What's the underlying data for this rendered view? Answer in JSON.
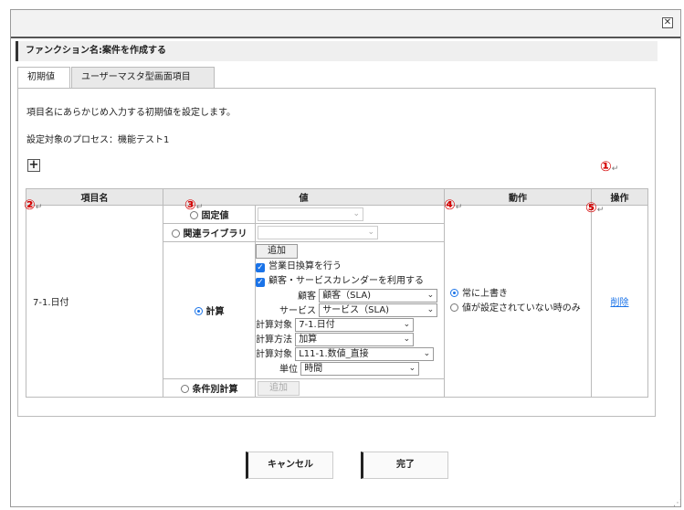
{
  "window": {
    "close_symbol": "✕"
  },
  "function_header": "ファンクション名:案件を作成する",
  "tabs": [
    {
      "label": "初期値",
      "active": true
    },
    {
      "label": "ユーザーマスタ型画面項目",
      "active": false
    }
  ],
  "description": "項目名にあらかじめ入力する初期値を設定します。",
  "process_label": "設定対象のプロセス：機能テスト1",
  "add_symbol": "+",
  "markers": {
    "m1": "①",
    "m2": "②",
    "m3": "③",
    "m4": "④",
    "m5": "⑤",
    "ret": "↵"
  },
  "table": {
    "headers": {
      "item_name": "項目名",
      "value": "値",
      "action": "動作",
      "operation": "操作"
    },
    "row": {
      "item_name": "7-1.日付",
      "options": {
        "fixed": "固定値",
        "library": "関連ライブラリ",
        "calc": "計算",
        "conditional": "条件別計算"
      },
      "fixed_select": "",
      "library_select": "",
      "add_button": "追加",
      "add_button_disabled": "追加",
      "business_day": "営業日換算を行う",
      "use_calendar": "顧客・サービスカレンダーを利用する",
      "customer_label": "顧客",
      "customer_value": "顧客（SLA)",
      "service_label": "サービス",
      "service_value": "サービス（SLA)",
      "target_label": "計算対象",
      "target_value": "7-1.日付",
      "method_label": "計算方法",
      "method_value": "加算",
      "target2_label": "計算対象",
      "target2_value": "L11-1.数値_直接",
      "unit_label": "単位",
      "unit_value": "時間",
      "action_always": "常に上書き",
      "action_if_empty": "値が設定されていない時のみ",
      "delete_link": "削除"
    }
  },
  "buttons": {
    "cancel": "キャンセル",
    "done": "完了"
  },
  "colors": {
    "accent": "#1a73e8",
    "marker": "#d40000"
  }
}
